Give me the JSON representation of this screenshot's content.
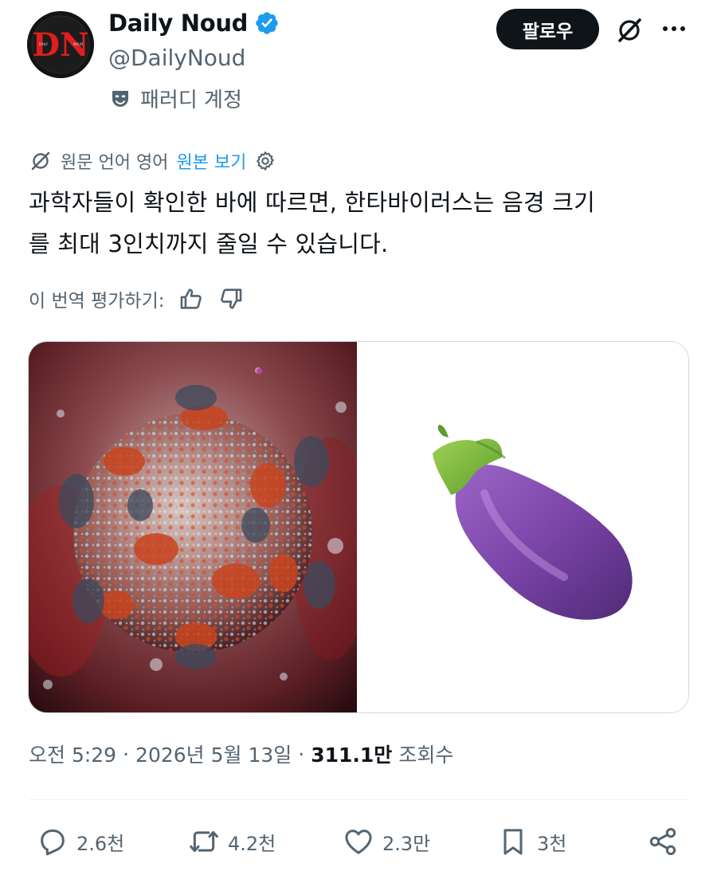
{
  "author": {
    "display_name": "Daily Noud",
    "handle": "@DailyNoud",
    "avatar_text": "DN",
    "avatar_small_left": "DAILY",
    "avatar_small_right": "NOUD",
    "verified": true,
    "parody_label": "패러디 계정"
  },
  "header": {
    "follow_label": "팔로우",
    "grok_icon": "grok-icon",
    "more_icon": "more-icon"
  },
  "translation": {
    "source_lang": "원문 언어 영어",
    "show_original": "원본 보기",
    "rate_label": "이 번역 평가하기:"
  },
  "tweet": {
    "text_line1": "과학자들이 확인한 바에 따르면, 한타바이러스는 음경 크기",
    "text_line2": "를 최대 3인치까지 줄일 수 있습니다."
  },
  "media": {
    "left_image": "hantavirus-illustration",
    "right_image": "eggplant-emoji"
  },
  "meta": {
    "time": "오전 5:29",
    "date": "2026년 5월 13일",
    "separator": "·",
    "views_count": "311.1만",
    "views_label": "조회수"
  },
  "actions": {
    "replies": "2.6천",
    "reposts": "4.2천",
    "likes": "2.3만",
    "bookmarks": "3천"
  },
  "colors": {
    "text_primary": "#0f1419",
    "text_secondary": "#536471",
    "link": "#1d9bf0",
    "verified": "#1d9bf0",
    "follow_bg": "#0f1419"
  }
}
